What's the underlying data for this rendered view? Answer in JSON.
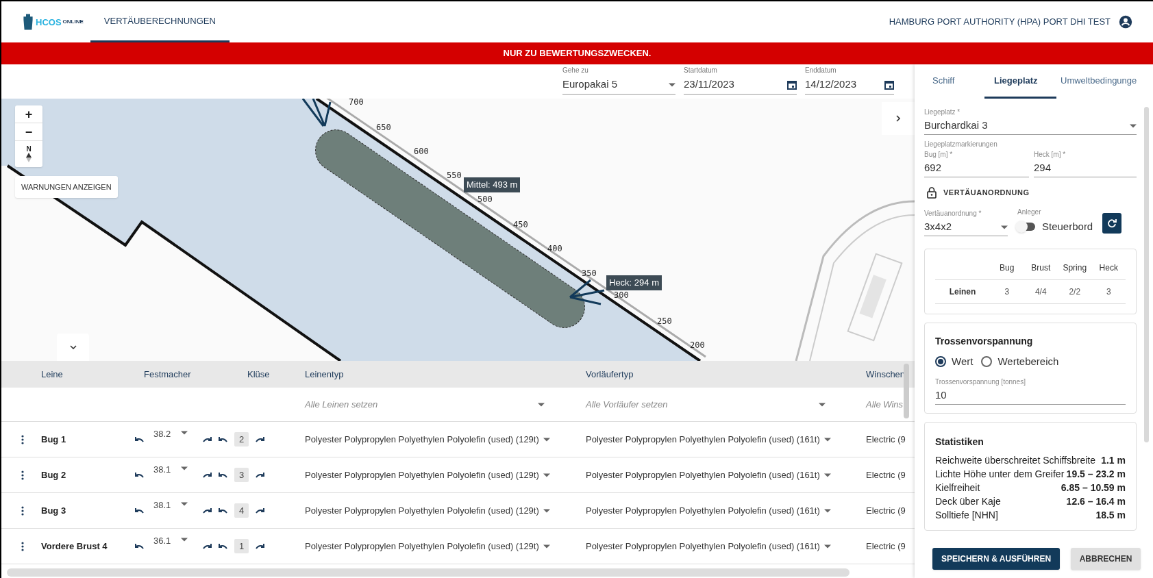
{
  "header": {
    "logo": {
      "mark": "HCOS",
      "word": "ONLINE"
    },
    "nav": [
      {
        "label": "VERTÄUBERECHNUNGEN",
        "selected": true
      }
    ],
    "user": "HAMBURG PORT AUTHORITY (HPA) PORT DHI TEST"
  },
  "banner": "NUR ZU BEWERTUNGSZWECKEN.",
  "filters": [
    {
      "kind": "select",
      "label": "Gehe zu",
      "value": "Europakai 5"
    },
    {
      "kind": "date",
      "label": "Startdatum",
      "value": "23/11/2023"
    },
    {
      "kind": "date",
      "label": "Enddatum",
      "value": "14/12/2023"
    }
  ],
  "map": {
    "zoom_in": "+",
    "zoom_out": "−",
    "north": "N",
    "warnings_button": "WARNUNGEN ANZEIGEN",
    "ruler": [
      "700",
      "650",
      "600",
      "550",
      "500",
      "450",
      "400",
      "350",
      "300",
      "250",
      "200"
    ],
    "labels": [
      {
        "text": "Mittel: 493 m"
      },
      {
        "text": "Heck: 294 m"
      }
    ]
  },
  "table": {
    "columns": [
      "Leine",
      "Festmacher",
      "Klüse",
      "Leinentyp",
      "Vorläufertyp",
      "Winschen"
    ],
    "filters": [
      "Alle Leinen setzen",
      "Alle Vorläufer setzen",
      "Alle Wins"
    ],
    "rows": [
      {
        "leine": "Bug 1",
        "festmacher": "38.2",
        "kluese": "2",
        "leinentyp": "Polyester Polypropylen Polyethylen Polyolefin (used) (129t)",
        "vorlaeufertyp": "Polyester Polypropylen Polyethylen Polyolefin (used) (161t)",
        "winsch": "Electric (9"
      },
      {
        "leine": "Bug 2",
        "festmacher": "38.1",
        "kluese": "3",
        "leinentyp": "Polyester Polypropylen Polyethylen Polyolefin (used) (129t)",
        "vorlaeufertyp": "Polyester Polypropylen Polyethylen Polyolefin (used) (161t)",
        "winsch": "Electric (9"
      },
      {
        "leine": "Bug 3",
        "festmacher": "38.1",
        "kluese": "4",
        "leinentyp": "Polyester Polypropylen Polyethylen Polyolefin (used) (129t)",
        "vorlaeufertyp": "Polyester Polypropylen Polyethylen Polyolefin (used) (161t)",
        "winsch": "Electric (9"
      },
      {
        "leine": "Vordere Brust 4",
        "festmacher": "36.1",
        "kluese": "1",
        "leinentyp": "Polyester Polypropylen Polyethylen Polyolefin (used) (129t)",
        "vorlaeufertyp": "Polyester Polypropylen Polyethylen Polyolefin (used) (161t)",
        "winsch": "Electric (9"
      }
    ]
  },
  "panel": {
    "tabs": [
      {
        "label": "Schiff",
        "selected": false
      },
      {
        "label": "Liegeplatz",
        "selected": true
      },
      {
        "label": "Umweltbedingunge",
        "selected": false
      }
    ],
    "berth": {
      "label": "Liegeplatz *",
      "value": "Burchardkai 3"
    },
    "markings_label": "Liegeplatzmarkierungen",
    "bug": {
      "label": "Bug [m] *",
      "value": "692"
    },
    "heck": {
      "label": "Heck [m] *",
      "value": "294"
    },
    "arrangement_title": "VERTÄUANORDNUNG",
    "arrangement": {
      "label": "Vertäuanordnung *",
      "value": "3x4x2"
    },
    "anleger": {
      "label": "Anleger",
      "on": false,
      "text": "Steuerbord"
    },
    "lines": {
      "columns": [
        "Bug",
        "Brust",
        "Spring",
        "Heck"
      ],
      "row_label": "Leinen",
      "values": [
        "3",
        "4/4",
        "2/2",
        "3"
      ]
    },
    "pretension": {
      "title": "Trossenvorspannung",
      "options": [
        {
          "label": "Wert",
          "selected": true
        },
        {
          "label": "Wertebereich",
          "selected": false
        }
      ],
      "field": {
        "label": "Trossenvorspannung [tonnes]",
        "value": "10"
      }
    },
    "stats": {
      "title": "Statistiken",
      "rows": [
        {
          "label": "Reichweite überschreitet Schiffsbreite",
          "value": "1.1 m"
        },
        {
          "label": "Lichte Höhe unter dem Greifer",
          "value": "19.5 – 23.2 m"
        },
        {
          "label": "Kielfreiheit",
          "value": "6.85 – 10.59 m"
        },
        {
          "label": "Deck über Kaje",
          "value": "12.6 – 16.4 m"
        },
        {
          "label": "Solltiefe [NHN]",
          "value": "18.5 m"
        }
      ]
    },
    "buttons": [
      {
        "kind": "primary",
        "label": "SPEICHERN & AUSFÜHREN"
      },
      {
        "kind": "secondary",
        "label": "ABBRECHEN"
      }
    ]
  }
}
